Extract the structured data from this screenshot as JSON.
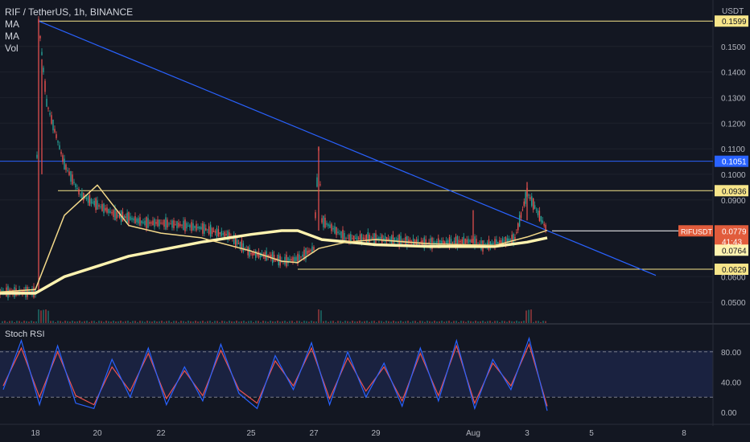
{
  "header": {
    "title": "RIF / TetherUS, 1h, BINANCE",
    "indicators": [
      "MA",
      "MA",
      "Vol"
    ],
    "unit": "USDT"
  },
  "colors": {
    "background": "#131722",
    "grid": "#1e222d",
    "up": "#26a69a",
    "down": "#ef5350",
    "hline_yellow": "#f7e58a",
    "hline_blue": "#2962ff",
    "trendline": "#2962ff",
    "ma_long": "#fff3b0",
    "ma_short": "#f3d98a",
    "stoch_k": "#2962ff",
    "stoch_d": "#ef5350",
    "badge_price": "#e15c3c"
  },
  "price_axis": {
    "labels": [
      "0.1599",
      "0.1500",
      "0.1400",
      "0.1300",
      "0.1200",
      "0.1100",
      "0.1051",
      "0.1000",
      "0.0936",
      "0.0900",
      "0.0779",
      "0.0764",
      "0.0629",
      "0.0600",
      "0.0500"
    ]
  },
  "badges": {
    "symbol": "RIFUSDT",
    "last_price": "0.0779",
    "countdown": "41:43",
    "ma_value": "0.0764",
    "level_1599": "0.1599",
    "level_1051": "0.1051",
    "level_0936": "0.0936",
    "level_0629": "0.0629"
  },
  "time_axis": {
    "labels": [
      "18",
      "20",
      "22",
      "25",
      "27",
      "29",
      "Aug",
      "3",
      "5",
      "8"
    ]
  },
  "stoch": {
    "label": "Stoch RSI",
    "levels": [
      "80.00",
      "40.00",
      "0.00"
    ]
  },
  "chart_data": {
    "type": "line",
    "title": "RIF / TetherUS, 1h, BINANCE",
    "ylabel": "USDT",
    "ylim": [
      0.045,
      0.165
    ],
    "x": [
      "17",
      "18",
      "18.3",
      "18.7",
      "19",
      "19.5",
      "20",
      "20.5",
      "21",
      "21.5",
      "22",
      "22.5",
      "23",
      "24",
      "25",
      "25.5",
      "26",
      "26.5",
      "27",
      "27.2",
      "27.5",
      "28",
      "29",
      "30",
      "31",
      "Aug",
      "1.5",
      "2",
      "2.5",
      "3",
      "3.2"
    ],
    "series": [
      {
        "values": [
          0.054,
          0.054,
          0.16,
          0.128,
          0.104,
          0.092,
          0.088,
          0.084,
          0.083,
          0.081,
          0.081,
          0.08,
          0.079,
          0.076,
          0.069,
          0.068,
          0.066,
          0.067,
          0.071,
          0.11,
          0.082,
          0.075,
          0.075,
          0.074,
          0.073,
          0.074,
          0.072,
          0.073,
          0.075,
          0.093,
          0.078
        ]
      }
    ],
    "levels": [
      0.1599,
      0.1051,
      0.0936,
      0.0629
    ],
    "last_price": 0.0779,
    "trendline": {
      "from": [
        "18",
        0.1599
      ],
      "to": [
        "5",
        0.0629
      ]
    },
    "stoch_rsi": {
      "ylim": [
        0,
        100
      ],
      "levels": [
        80,
        20
      ],
      "k": [
        30,
        95,
        10,
        88,
        12,
        5,
        70,
        20,
        85,
        10,
        60,
        15,
        90,
        25,
        5,
        75,
        30,
        92,
        10,
        80,
        20,
        65,
        8,
        85,
        15,
        95,
        5,
        70,
        30,
        98,
        2
      ],
      "d": [
        35,
        85,
        20,
        80,
        22,
        10,
        60,
        28,
        78,
        18,
        55,
        22,
        82,
        30,
        12,
        68,
        35,
        85,
        18,
        72,
        28,
        60,
        15,
        78,
        22,
        88,
        12,
        65,
        35,
        90,
        8
      ]
    }
  }
}
